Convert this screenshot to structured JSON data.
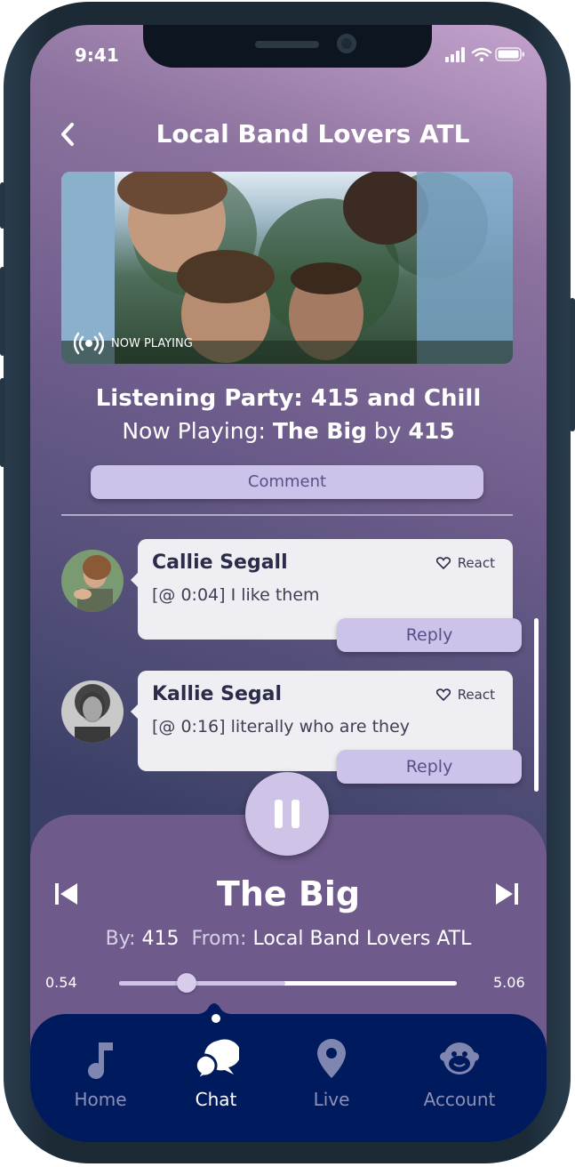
{
  "status_bar": {
    "time": "9:41"
  },
  "header": {
    "title": "Local Band Lovers ATL"
  },
  "video": {
    "badge": "NOW PLAYING"
  },
  "party": {
    "title": "Listening Party: 415 and Chill",
    "now_playing_label": "Now Playing:",
    "song": "The Big",
    "by_label": "by",
    "artist": "415"
  },
  "comment_button": "Comment",
  "comments": [
    {
      "name": "Callie Segall",
      "text": "[@ 0:04] I like them",
      "react_label": "React",
      "reply_label": "Reply"
    },
    {
      "name": "Kallie Segal",
      "text": "[@ 0:16] literally who are they",
      "react_label": "React",
      "reply_label": "Reply"
    }
  ],
  "player": {
    "title": "The Big",
    "by_label": "By:",
    "artist": "415",
    "from_label": "From:",
    "source": "Local Band Lovers ATL",
    "elapsed": "0.54",
    "duration": "5.06",
    "progress_fraction": 0.2
  },
  "nav": {
    "items": [
      {
        "label": "Home",
        "icon": "music-note-icon",
        "active": false
      },
      {
        "label": "Chat",
        "icon": "chat-bubbles-icon",
        "active": true
      },
      {
        "label": "Live",
        "icon": "location-pin-icon",
        "active": false
      },
      {
        "label": "Account",
        "icon": "monkey-avatar-icon",
        "active": false
      }
    ]
  },
  "colors": {
    "accent": "#cdc3ea",
    "player_bg": "#6e5b8c",
    "nav_bg": "#001a5e"
  }
}
